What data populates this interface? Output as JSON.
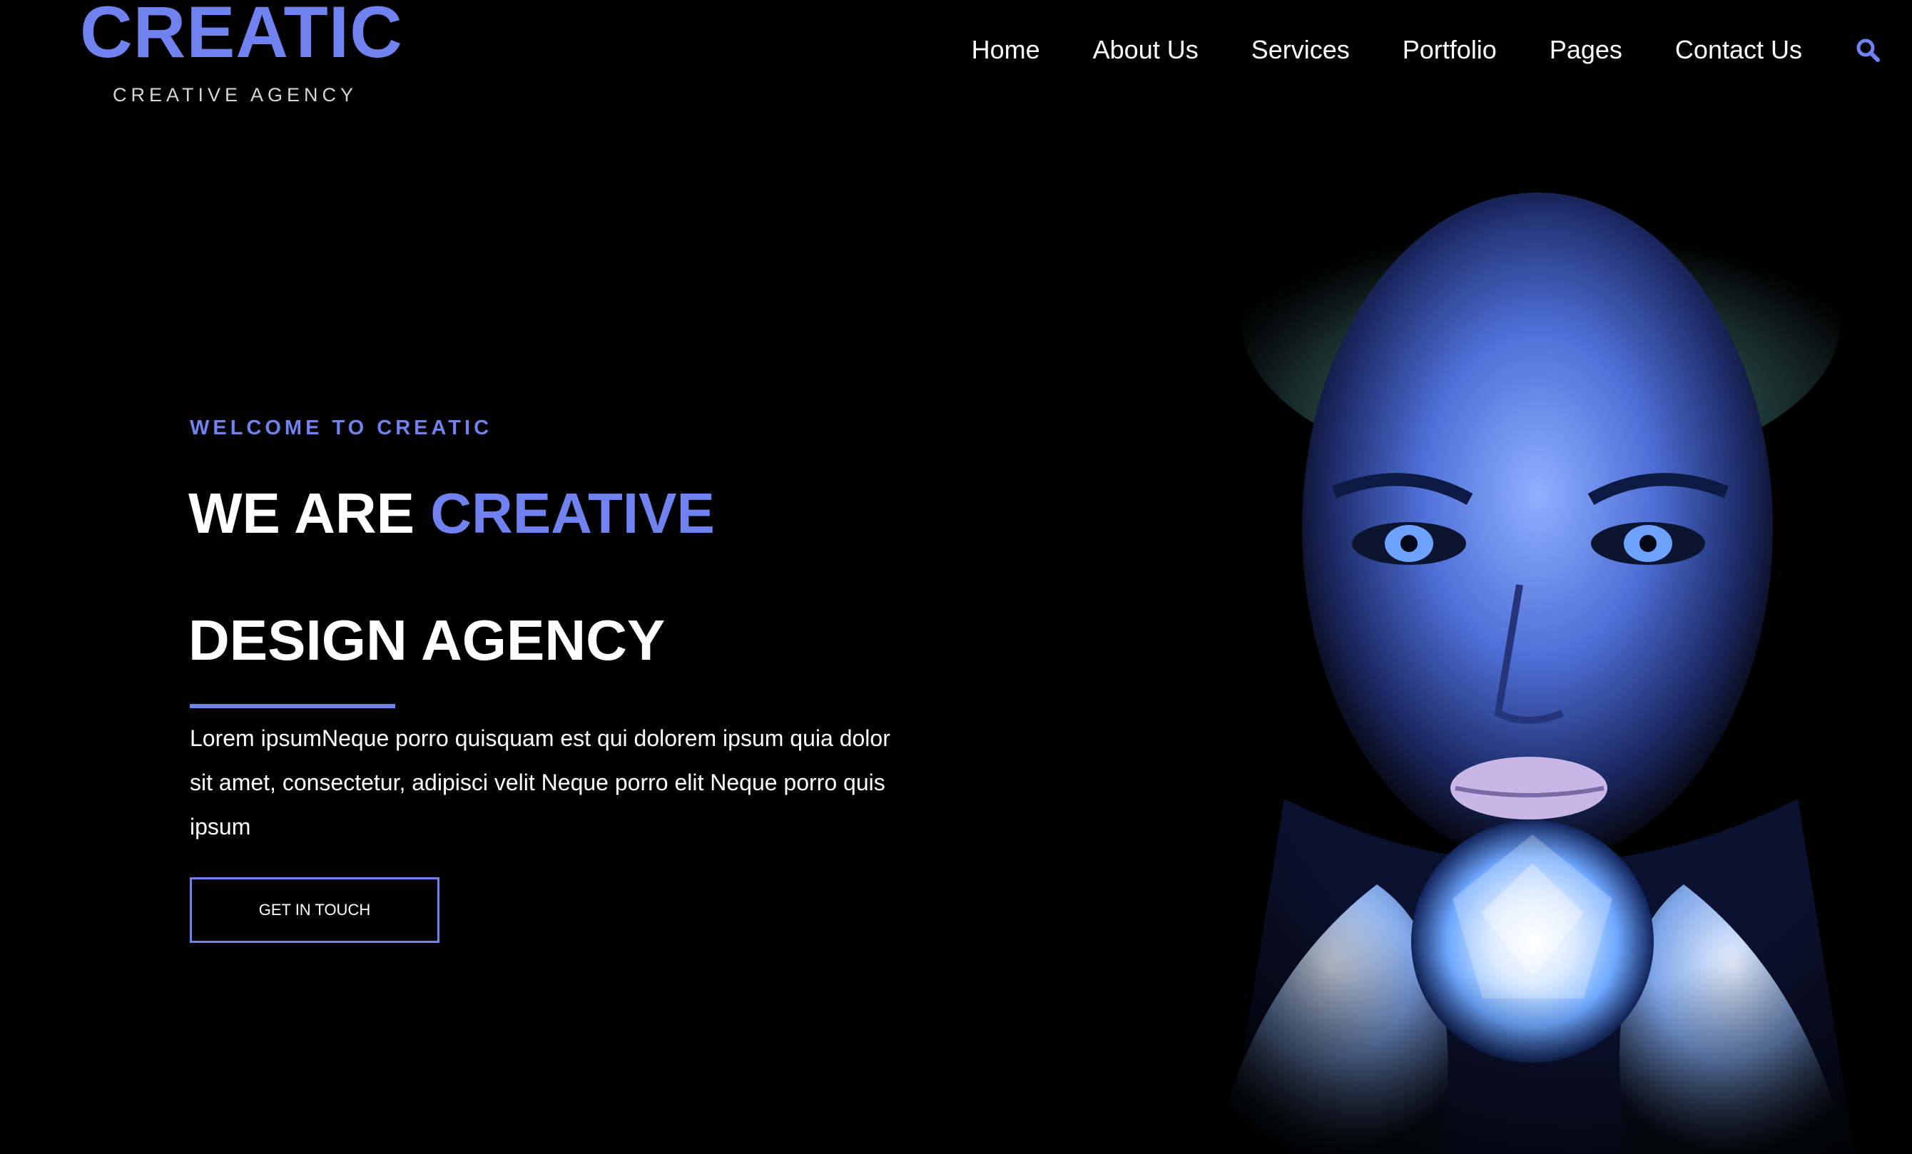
{
  "theme": {
    "accent": "#6f82f0",
    "background": "#000000",
    "text": "#ffffff"
  },
  "header": {
    "logo_main": "CREATIC",
    "logo_sub": "CREATIVE AGENCY",
    "nav": [
      "Home",
      "About Us",
      "Services",
      "Portfolio",
      "Pages",
      "Contact Us"
    ],
    "search_icon": "search-icon"
  },
  "hero": {
    "kicker": "WELCOME TO CREATIC",
    "headline_white": "WE ARE ",
    "headline_accent": "CREATIVE",
    "headline_line2": "DESIGN AGENCY",
    "body": "Lorem ipsumNeque porro quisquam est qui dolorem ipsum quia dolor sit amet, consectetur, adipisci velit Neque porro elit Neque porro quis ipsum",
    "cta_label": "GET IN TOUCH"
  }
}
